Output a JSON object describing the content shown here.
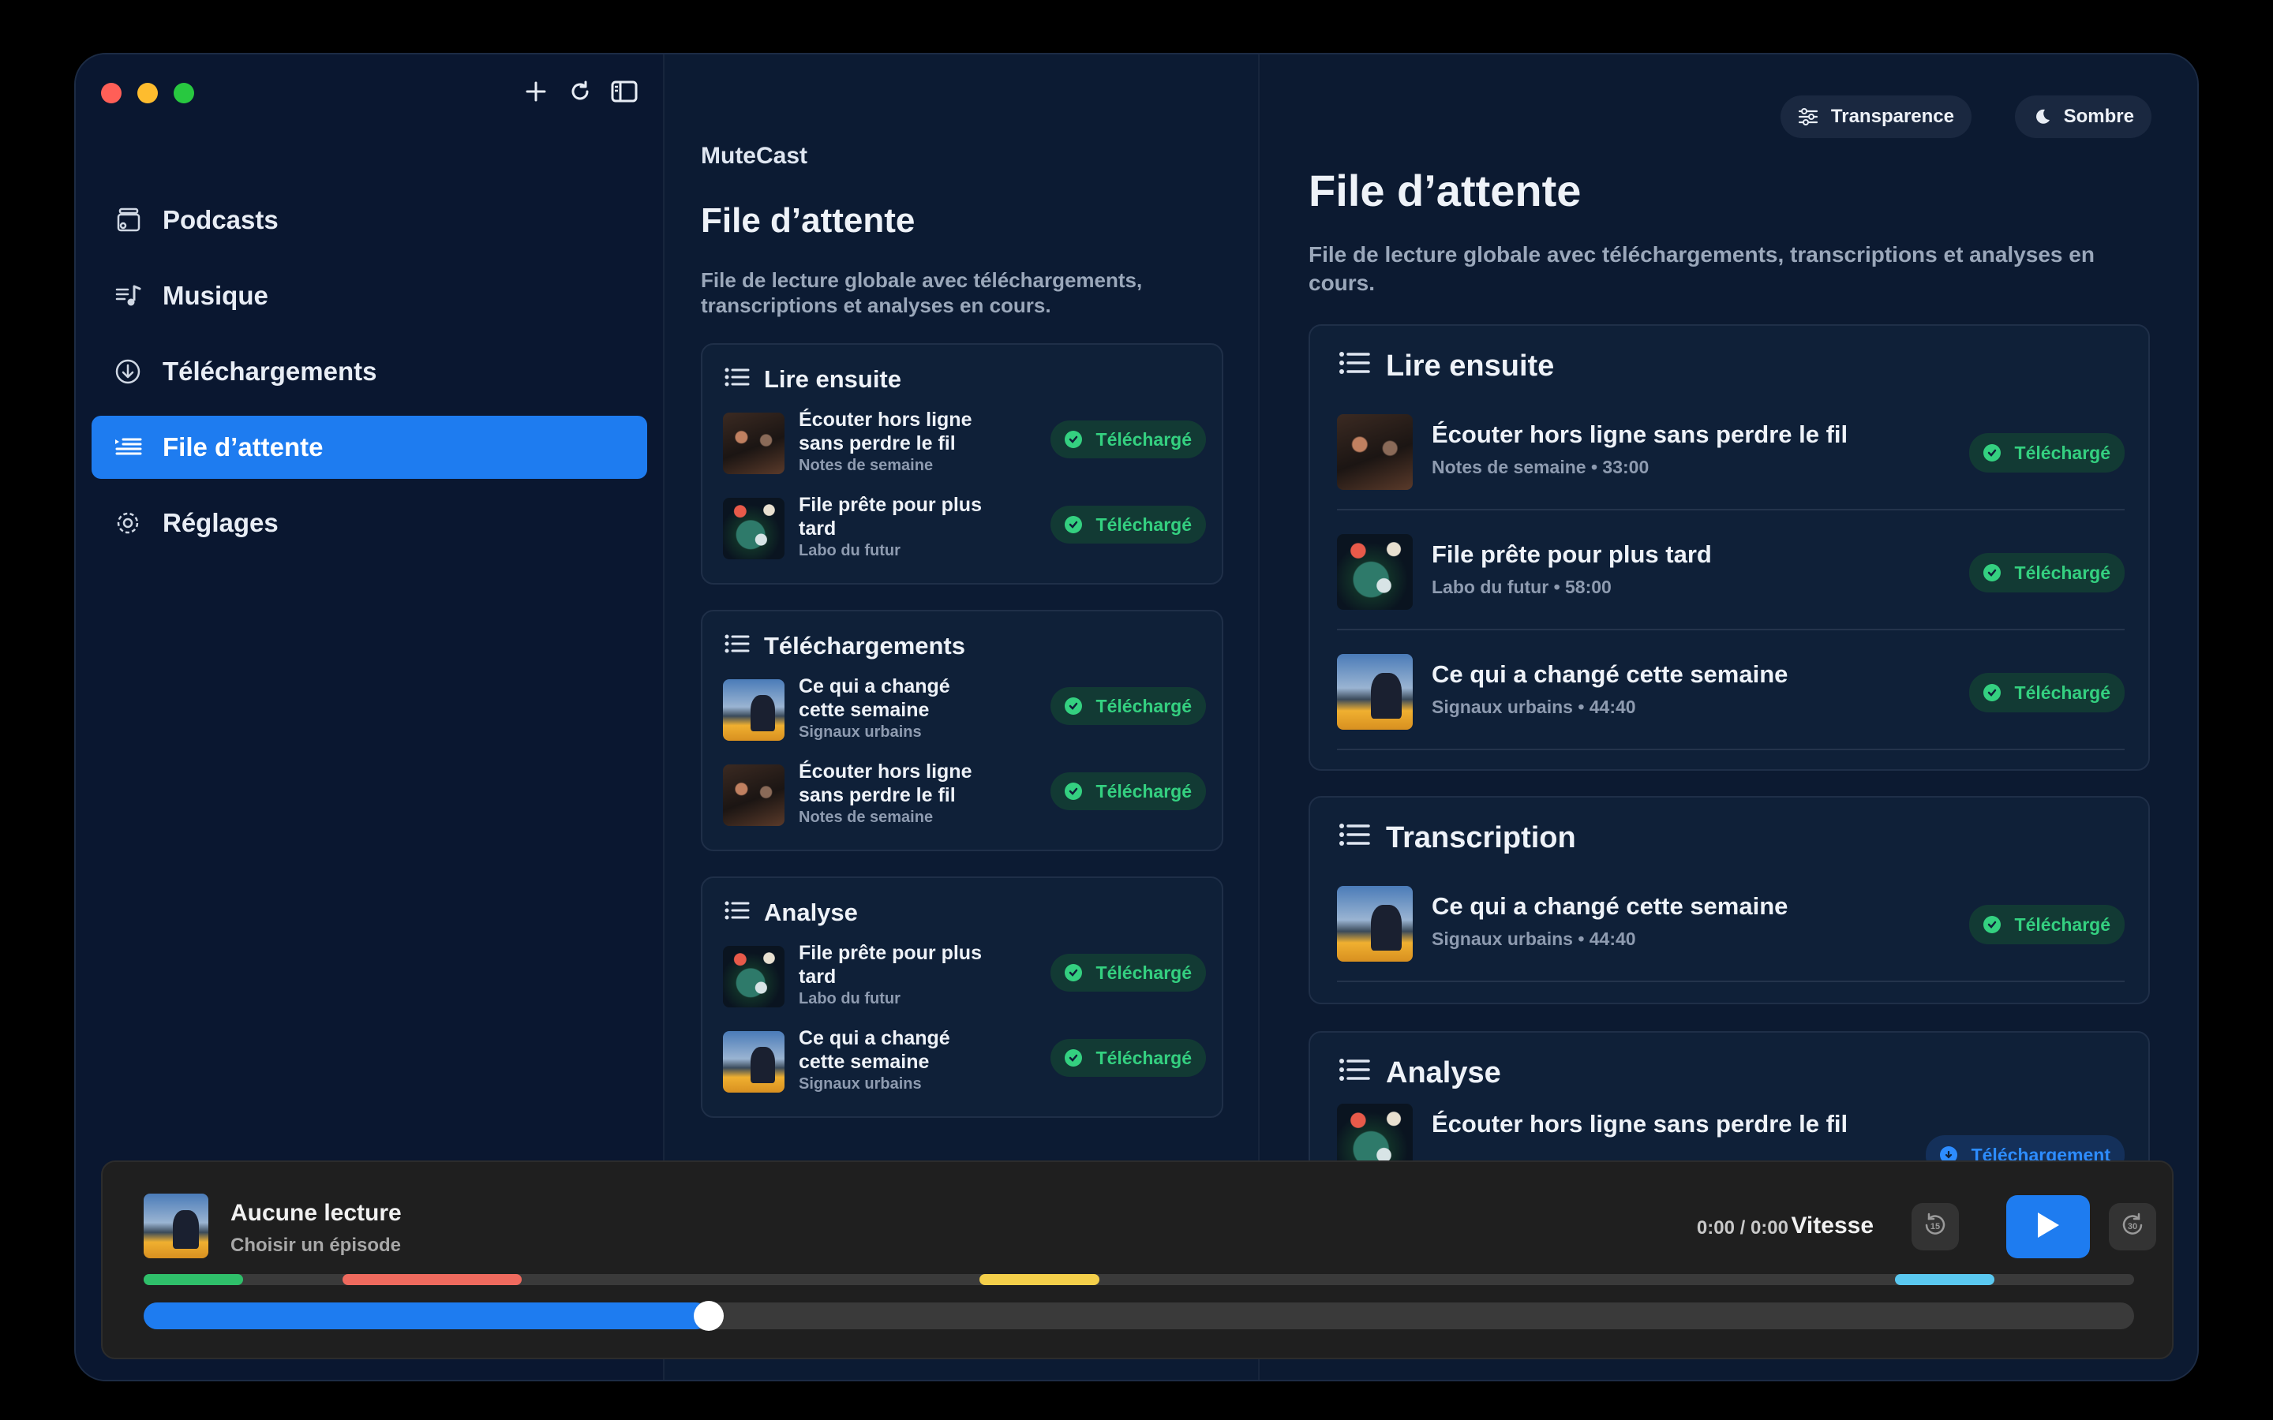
{
  "sidebar": {
    "items": [
      {
        "label": "Podcasts",
        "icon": "podcasts-icon"
      },
      {
        "label": "Musique",
        "icon": "music-icon"
      },
      {
        "label": "Téléchargements",
        "icon": "download-icon"
      },
      {
        "label": "File d’attente",
        "icon": "queue-icon",
        "active": true
      },
      {
        "label": "Réglages",
        "icon": "gear-icon"
      }
    ]
  },
  "middle": {
    "app_name": "MuteCast",
    "title": "File d’attente",
    "subtitle": "File de lecture globale avec téléchargements, transcriptions et analyses en cours.",
    "sections": [
      {
        "title": "Lire ensuite",
        "rows": [
          {
            "title": "Écouter hors ligne sans perdre le fil",
            "source": "Notes de semaine",
            "status": "Téléchargé"
          },
          {
            "title": "File prête pour plus tard",
            "source": "Labo du futur",
            "status": "Téléchargé"
          }
        ]
      },
      {
        "title": "Téléchargements",
        "rows": [
          {
            "title": "Ce qui a changé cette semaine",
            "source": "Signaux urbains",
            "status": "Téléchargé"
          },
          {
            "title": "Écouter hors ligne sans perdre le fil",
            "source": "Notes de semaine",
            "status": "Téléchargé"
          }
        ]
      },
      {
        "title": "Analyse",
        "rows": [
          {
            "title": "File prête pour plus tard",
            "source": "Labo du futur",
            "status": "Téléchargé"
          },
          {
            "title": "Ce qui a changé cette semaine",
            "source": "Signaux urbains",
            "status": "Téléchargé"
          }
        ]
      }
    ]
  },
  "right": {
    "buttons": {
      "transparency": "Transparence",
      "dark": "Sombre"
    },
    "title": "File d’attente",
    "subtitle": "File de lecture globale avec téléchargements, transcriptions et analyses en cours.",
    "sections": [
      {
        "title": "Lire ensuite",
        "rows": [
          {
            "title": "Écouter hors ligne sans perdre le fil",
            "meta": "Notes de semaine • 33:00",
            "status": "Téléchargé"
          },
          {
            "title": "File prête pour plus tard",
            "meta": "Labo du futur • 58:00",
            "status": "Téléchargé"
          },
          {
            "title": "Ce qui a changé cette semaine",
            "meta": "Signaux urbains • 44:40",
            "status": "Téléchargé"
          }
        ]
      },
      {
        "title": "Transcription",
        "rows": [
          {
            "title": "Ce qui a changé cette semaine",
            "meta": "Signaux urbains • 44:40",
            "status": "Téléchargé"
          }
        ]
      },
      {
        "title": "Analyse",
        "rows": [
          {
            "title": "Écouter hors ligne sans perdre le fil",
            "meta": "",
            "status": "Téléchargement"
          }
        ]
      }
    ]
  },
  "player": {
    "title": "Aucune lecture",
    "subtitle": "Choisir un épisode",
    "time": "0:00 / 0:00",
    "speed_label": "Vitesse",
    "skip_back": "15",
    "skip_forward": "30",
    "progress_fraction": 0.28,
    "segments": [
      {
        "start": 0.0,
        "end": 0.05,
        "color": "#2fbf6a"
      },
      {
        "start": 0.1,
        "end": 0.19,
        "color": "#ef6a5e"
      },
      {
        "start": 0.42,
        "end": 0.48,
        "color": "#f4cf4a"
      },
      {
        "start": 0.88,
        "end": 0.93,
        "color": "#5ac8f0"
      }
    ]
  },
  "colors": {
    "accent": "#1e7cf0",
    "success": "#34d080",
    "window_bg": "#0b1a30"
  }
}
